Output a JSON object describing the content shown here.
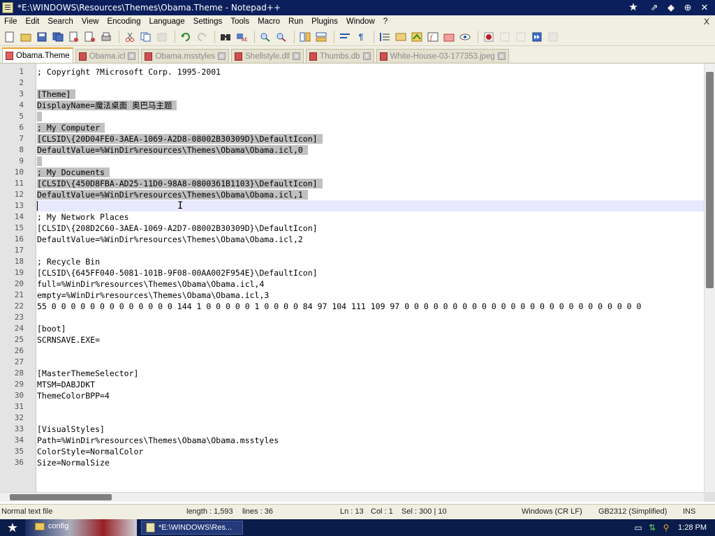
{
  "window": {
    "title": "*E:\\WINDOWS\\Resources\\Themes\\Obama.Theme - Notepad++",
    "controls": {
      "minimize": "⇗",
      "restore": "◆",
      "maximize": "⊕",
      "close": "✕"
    }
  },
  "menu": {
    "items": [
      "File",
      "Edit",
      "Search",
      "View",
      "Encoding",
      "Language",
      "Settings",
      "Tools",
      "Macro",
      "Run",
      "Plugins",
      "Window",
      "?"
    ],
    "close_label": "X"
  },
  "toolbar": {
    "icons": [
      "new-file-icon",
      "open-file-icon",
      "save-icon",
      "save-all-icon",
      "close-icon",
      "close-all-icon",
      "print-icon",
      "cut-icon",
      "copy-icon",
      "paste-icon",
      "undo-icon",
      "redo-icon",
      "find-icon",
      "replace-icon",
      "zoom-in-icon",
      "zoom-out-icon",
      "sync-vertical-icon",
      "sync-horizontal-icon",
      "word-wrap-icon",
      "show-all-chars-icon",
      "indent-guide-icon",
      "user-language-icon",
      "doc-map-icon",
      "function-list-icon",
      "folder-workspace-icon",
      "monitor-icon",
      "record-macro-icon",
      "stop-macro-icon",
      "play-macro-icon",
      "run-macro-multiple-icon",
      "save-macro-icon"
    ]
  },
  "tabs": [
    {
      "label": "Obama.Theme",
      "active": true
    },
    {
      "label": "Obama.icl",
      "active": false
    },
    {
      "label": "Obama.msstyles",
      "active": false
    },
    {
      "label": "Shellstyle.dll",
      "active": false
    },
    {
      "label": "Thumbs.db",
      "active": false
    },
    {
      "label": "White-House-03-177353.jpeg",
      "active": false
    }
  ],
  "editor": {
    "lines": [
      "; Copyright ?Microsoft Corp. 1995-2001",
      "",
      "[Theme]",
      "DisplayName=魔法桌面 奥巴马主题",
      "",
      "; My Computer",
      "[CLSID\\{20D04FE0-3AEA-1069-A2D8-08002B30309D}\\DefaultIcon]",
      "DefaultValue=%WinDir%resources\\Themes\\Obama\\Obama.icl,0",
      "",
      "; My Documents",
      "[CLSID\\{450D8FBA-AD25-11D0-98A8-0800361B1103}\\DefaultIcon]",
      "DefaultValue=%WinDir%resources\\Themes\\Obama\\Obama.icl,1",
      "",
      "; My Network Places",
      "[CLSID\\{208D2C60-3AEA-1069-A2D7-08002B30309D}\\DefaultIcon]",
      "DefaultValue=%WinDir%resources\\Themes\\Obama\\Obama.icl,2",
      "",
      "; Recycle Bin",
      "[CLSID\\{645FF040-5081-101B-9F08-00AA002F954E}\\DefaultIcon]",
      "full=%WinDir%resources\\Themes\\Obama\\Obama.icl,4",
      "empty=%WinDir%resources\\Themes\\Obama\\Obama.icl,3",
      "55 0 0 0 0 0 0 0 0 0 0 0 0 0 144 1 0 0 0 0 0 1 0 0 0 0 84 97 104 111 109 97 0 0 0 0 0 0 0 0 0 0 0 0 0 0 0 0 0 0 0 0 0 0 0 0 0",
      "",
      "[boot]",
      "SCRNSAVE.EXE=",
      "",
      "",
      "[MasterThemeSelector]",
      "MTSM=DABJDKT",
      "ThemeColorBPP=4",
      "",
      "",
      "[VisualStyles]",
      "Path=%WinDir%resources\\Themes\\Obama\\Obama.msstyles",
      "ColorStyle=NormalColor",
      "Size=NormalSize"
    ],
    "selected_lines": [
      3,
      4,
      5,
      6,
      7,
      8,
      9,
      10,
      11,
      12,
      13
    ],
    "current_line": 13
  },
  "status": {
    "type": "Normal text file",
    "length": "length : 1,593",
    "lines": "lines : 36",
    "ln": "Ln : 13",
    "col": "Col : 1",
    "sel": "Sel : 300 | 10",
    "eol": "Windows (CR LF)",
    "encoding": "GB2312 (Simplified)",
    "mode": "INS"
  },
  "taskbar": {
    "folder_label": "config",
    "window_label": "*E:\\WINDOWS\\Res...",
    "clock": "1:28 PM"
  },
  "colors": {
    "titlebar": "#0b1f5c",
    "selection": "#c0c0c0",
    "current_line": "#e8e8ff",
    "active_tab_accent": "#f0a030"
  }
}
